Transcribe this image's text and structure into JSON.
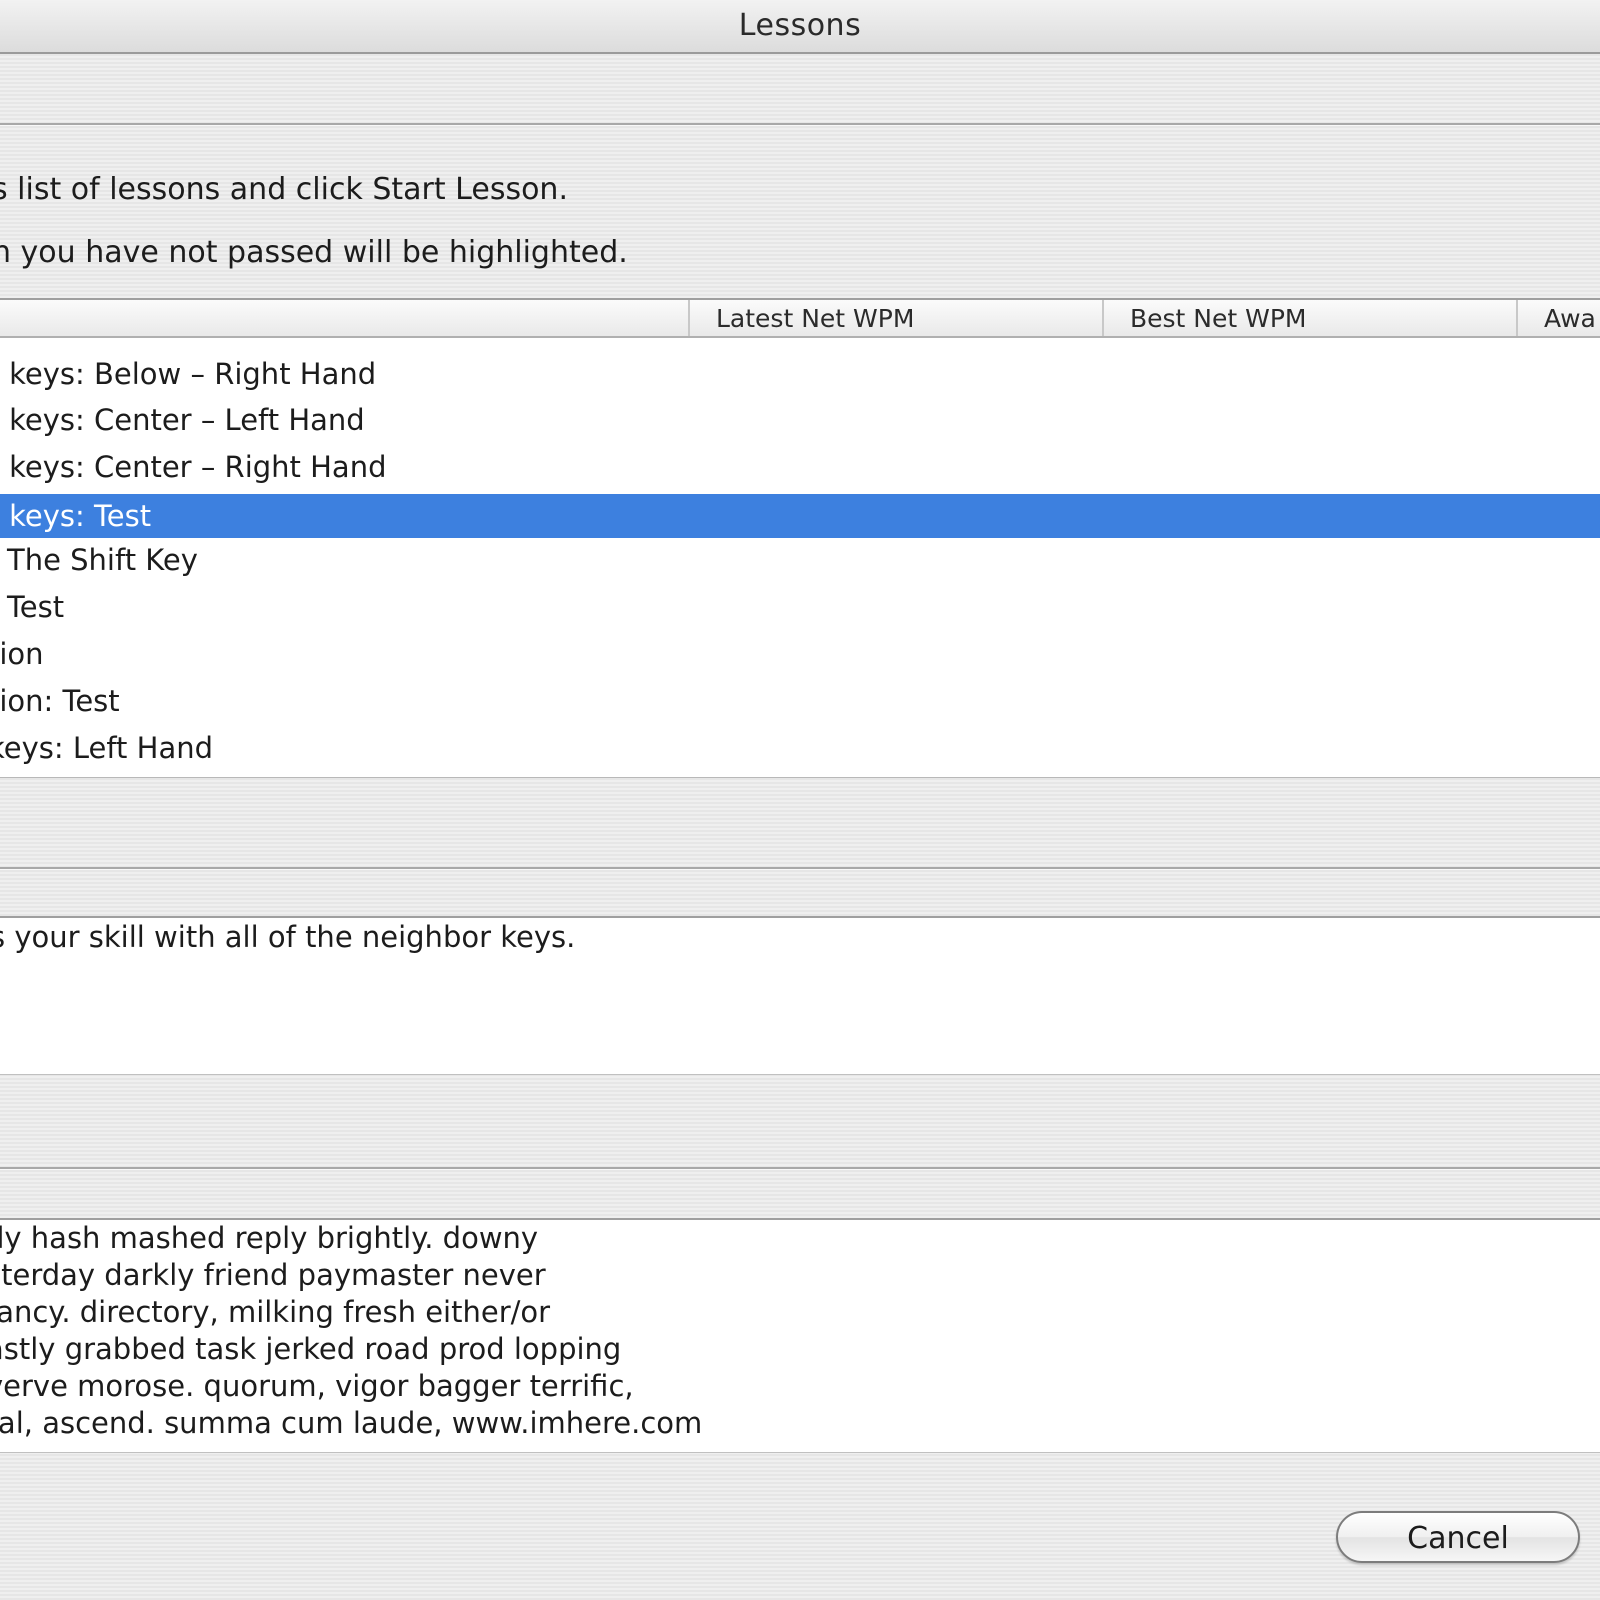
{
  "window": {
    "title": "Lessons"
  },
  "instructions": {
    "line1": "s list of lessons and click Start Lesson.",
    "line2": "n you have not passed will be highlighted."
  },
  "table": {
    "columns": [
      "Latest Net WPM",
      "Best Net WPM",
      "Awa"
    ],
    "rows": [
      {
        "name": "r keys: Below – Right Hand",
        "selected": false
      },
      {
        "name": "r keys: Center – Left Hand",
        "selected": false
      },
      {
        "name": "r keys: Center – Right Hand",
        "selected": false
      },
      {
        "name": "r keys: Test",
        "selected": true
      },
      {
        "name": ": The Shift Key",
        "selected": false
      },
      {
        "name": ": Test",
        "selected": false
      },
      {
        "name": "tion",
        "selected": false
      },
      {
        "name": "tion: Test",
        "selected": false
      },
      {
        "name": " keys: Left Hand",
        "selected": false
      }
    ],
    "selected_color": "#3d80df"
  },
  "description": {
    "text": "s your skill with all of the neighbor keys."
  },
  "sample": {
    "lines": [
      "dy hash mashed reply brightly. downy",
      "sterday darkly friend paymaster never",
      " fancy. directory, milking fresh either/or",
      "astly grabbed task jerked road prod lopping",
      "verve morose. quorum, vigor bagger terrific,",
      "ral, ascend. summa cum laude, www.imhere.com"
    ]
  },
  "buttons": {
    "cancel_label": "Cancel"
  }
}
